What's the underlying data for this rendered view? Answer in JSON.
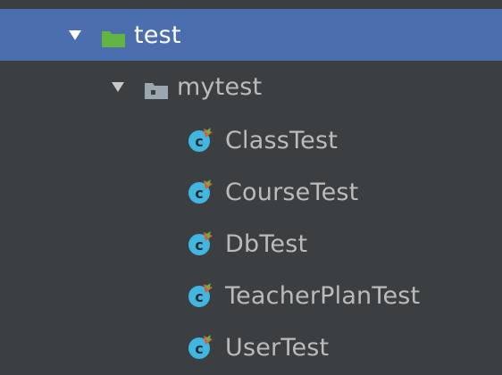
{
  "tree": {
    "items": [
      {
        "label": "test",
        "icon": "test-folder-icon",
        "expanded": true,
        "selected": true
      },
      {
        "label": "mytest",
        "icon": "package-folder-icon",
        "expanded": true,
        "selected": false
      },
      {
        "label": "ClassTest",
        "icon": "junit-test-class-icon"
      },
      {
        "label": "CourseTest",
        "icon": "junit-test-class-icon"
      },
      {
        "label": "DbTest",
        "icon": "junit-test-class-icon"
      },
      {
        "label": "TeacherPlanTest",
        "icon": "junit-test-class-icon"
      },
      {
        "label": "UserTest",
        "icon": "junit-test-class-icon"
      }
    ]
  },
  "colors": {
    "background": "#3c3f41",
    "selection": "#4b6eaf",
    "text": "#bbbbbb",
    "selected_text": "#ffffff",
    "test_folder": "#62b543",
    "package_folder": "#9aa7b0",
    "class_icon": "#40b6e0",
    "test_badge": "#e05b34"
  }
}
